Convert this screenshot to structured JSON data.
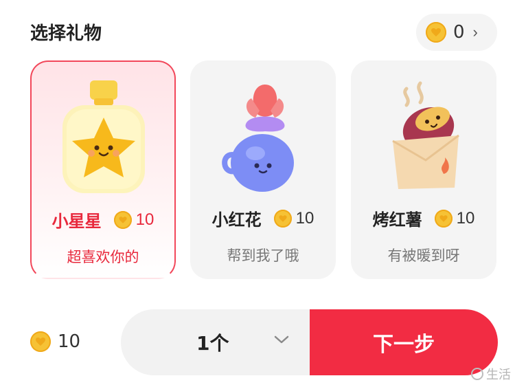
{
  "header": {
    "title": "选择礼物"
  },
  "balance": {
    "value": "0",
    "chevron": "›",
    "icon": "coin-icon"
  },
  "gifts": [
    {
      "name": "小星星",
      "price": "10",
      "desc": "超喜欢你的",
      "selected": true,
      "icon": "star-bottle-icon"
    },
    {
      "name": "小红花",
      "price": "10",
      "desc": "帮到我了哦",
      "selected": false,
      "icon": "flower-vase-icon"
    },
    {
      "name": "烤红薯",
      "price": "10",
      "desc": "有被暖到呀",
      "selected": false,
      "icon": "sweet-potato-icon"
    }
  ],
  "footer": {
    "total": "10",
    "quantity": "1个",
    "next_label": "下一步"
  },
  "watermark": {
    "text": "生活"
  },
  "colors": {
    "accent": "#f22c43",
    "coin": "#f6c235",
    "card_bg": "#f4f4f4"
  }
}
